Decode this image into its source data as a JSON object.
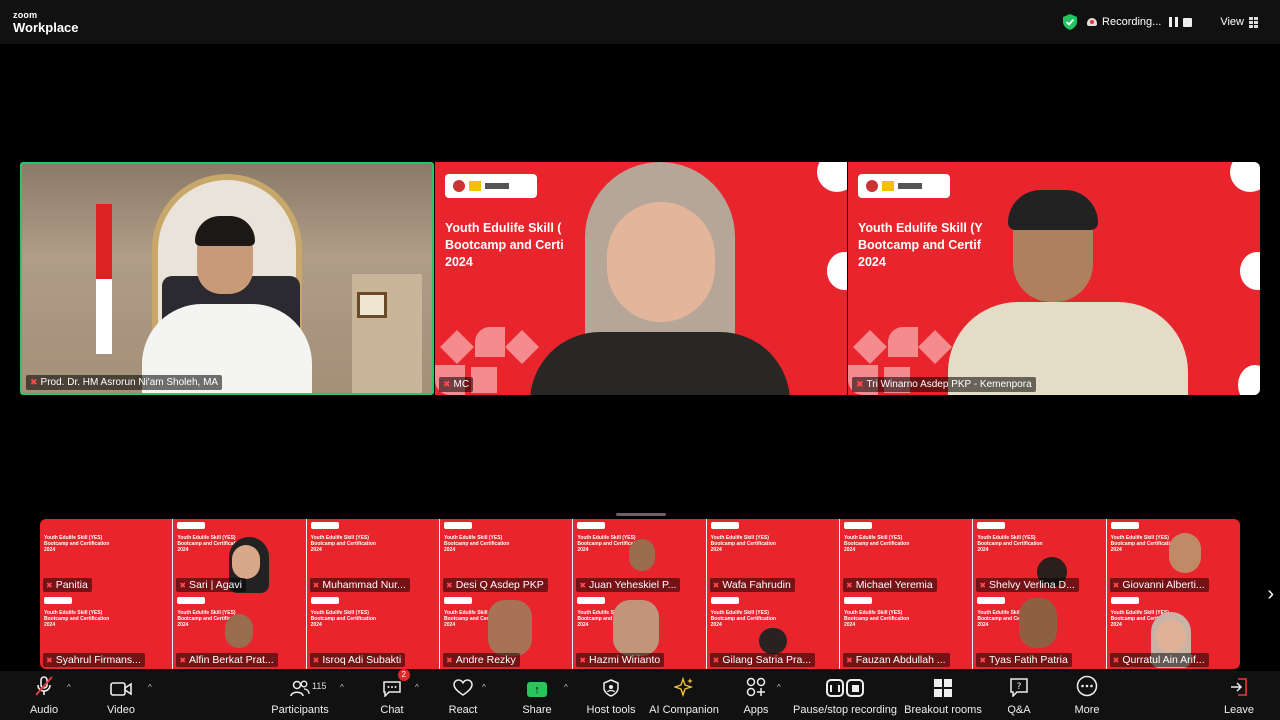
{
  "app": {
    "brand_top": "zoom",
    "brand_bottom": "Workplace"
  },
  "topbar": {
    "recording_label": "Recording...",
    "view_label": "View"
  },
  "speakers": [
    {
      "name": "Prod. Dr. HM Asrorun Ni'am Sholeh, MA"
    },
    {
      "name": "MC"
    },
    {
      "name": "Tri Winarno Asdep PKP - Kemenpora"
    }
  ],
  "event": {
    "title": "Youth Edulife Skill (YES)\nBootcamp and Certification\n2024",
    "title_cropped_1": "Youth Edulife Skill (\nBootcamp and Certi\n2024",
    "title_cropped_2": "Youth Edulife Skill (Y\nBootcamp and Certif\n2024"
  },
  "gallery": {
    "row1": [
      "Panitia",
      "Sari | Agavi",
      "Muhammad Nur...",
      "Desi Q Asdep PKP",
      "Juan Yeheskiel P...",
      "Wafa Fahrudin",
      "Michael Yeremia",
      "Shelvy Verlina D...",
      "Giovanni Alberti..."
    ],
    "row2": [
      "Syahrul Firmans...",
      "Alfin Berkat Prat...",
      "Isroq Adi Subakti",
      "Andre Rezky",
      "Hazmi Wirianto",
      "Gilang Satria Pra...",
      "Fauzan Abdullah ...",
      "Tyas Fatih Patria",
      "Qurratul Ain Arif..."
    ]
  },
  "toolbar": {
    "audio": "Audio",
    "video": "Video",
    "participants": "Participants",
    "participants_count": "115",
    "chat": "Chat",
    "chat_badge": "2",
    "react": "React",
    "share": "Share",
    "host_tools": "Host tools",
    "ai_companion": "AI Companion",
    "apps": "Apps",
    "pause_recording": "Pause/stop recording",
    "breakout_rooms": "Breakout rooms",
    "qa": "Q&A",
    "more": "More",
    "leave": "Leave"
  },
  "colors": {
    "brand_red": "#e8242c",
    "active_speaker": "#2ac66a",
    "share_green": "#27c55a"
  }
}
